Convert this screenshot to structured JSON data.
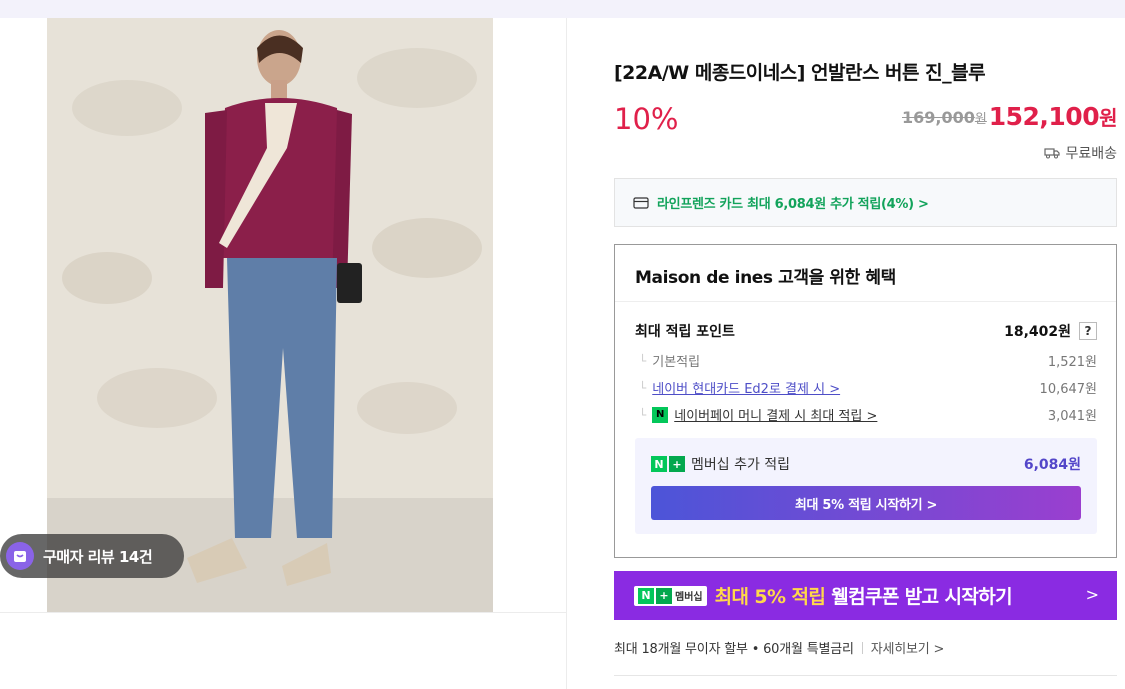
{
  "gallery": {
    "review_badge": "구매자 리뷰 14건"
  },
  "product": {
    "title": "[22A/W 메종드이네스] 언발란스 버튼 진_블루",
    "discount": "10%",
    "original_price": "169,000",
    "original_unit": "원",
    "price": "152,100",
    "price_unit": "원",
    "delivery": "무료배송"
  },
  "card_promo": {
    "text": "라인프렌즈 카드 최대 6,084원 추가 적립(4%) >"
  },
  "benefits": {
    "title": "Maison de ines 고객을 위한 혜택",
    "max_points_label": "최대 적립 포인트",
    "max_points_value": "18,402원",
    "help": "?",
    "rows": [
      {
        "label": "기본적립",
        "value": "1,521원"
      },
      {
        "label": "네이버 현대카드 Ed2로 결제 시 >",
        "value": "10,647원"
      },
      {
        "label": "네이버페이 머니 결제 시 최대 적립 >",
        "value": "3,041원"
      }
    ],
    "membership": {
      "label": "멤버십 추가 적립",
      "value": "6,084원",
      "button": "최대 5% 적립 시작하기 >"
    }
  },
  "coupon_banner": {
    "logo_text": "멤버십",
    "highlight": "최대 5% 적립",
    "text": " 웰컴쿠폰 받고 시작하기",
    "arrow": ">"
  },
  "installment": {
    "text": "최대 18개월 무이자 할부 • 60개월 특별금리",
    "more": "자세히보기 >"
  },
  "colors": {
    "accent_red": "#e0204a",
    "naver_green": "#03c75a",
    "purple": "#8a2be2"
  }
}
